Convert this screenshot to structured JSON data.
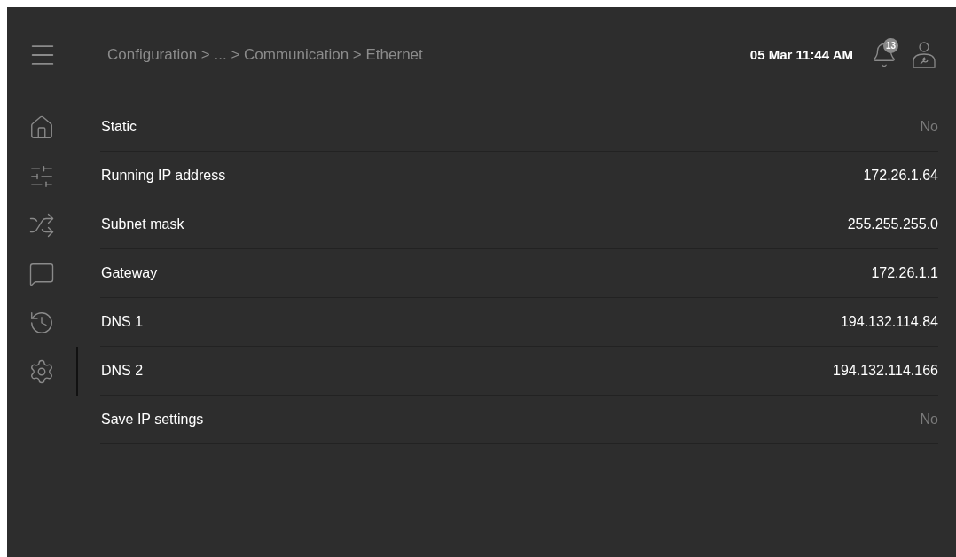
{
  "header": {
    "breadcrumb": "Configuration > ... > Communication > Ethernet",
    "datetime": "05 Mar 11:44 AM",
    "notification_count": "13"
  },
  "sidebar": {
    "items": [
      {
        "kind": "home",
        "selected": false
      },
      {
        "kind": "sliders",
        "selected": false
      },
      {
        "kind": "shuffle",
        "selected": false
      },
      {
        "kind": "message",
        "selected": false
      },
      {
        "kind": "history",
        "selected": false
      },
      {
        "kind": "settings",
        "selected": true
      }
    ]
  },
  "settings": [
    {
      "label": "Static",
      "value": "No",
      "disabled": true
    },
    {
      "label": "Running IP address",
      "value": "172.26.1.64",
      "disabled": false
    },
    {
      "label": "Subnet mask",
      "value": "255.255.255.0",
      "disabled": false
    },
    {
      "label": "Gateway",
      "value": "172.26.1.1",
      "disabled": false
    },
    {
      "label": "DNS 1",
      "value": "194.132.114.84",
      "disabled": false
    },
    {
      "label": "DNS 2",
      "value": "194.132.114.166",
      "disabled": false
    },
    {
      "label": "Save IP settings",
      "value": "No",
      "disabled": true
    }
  ]
}
